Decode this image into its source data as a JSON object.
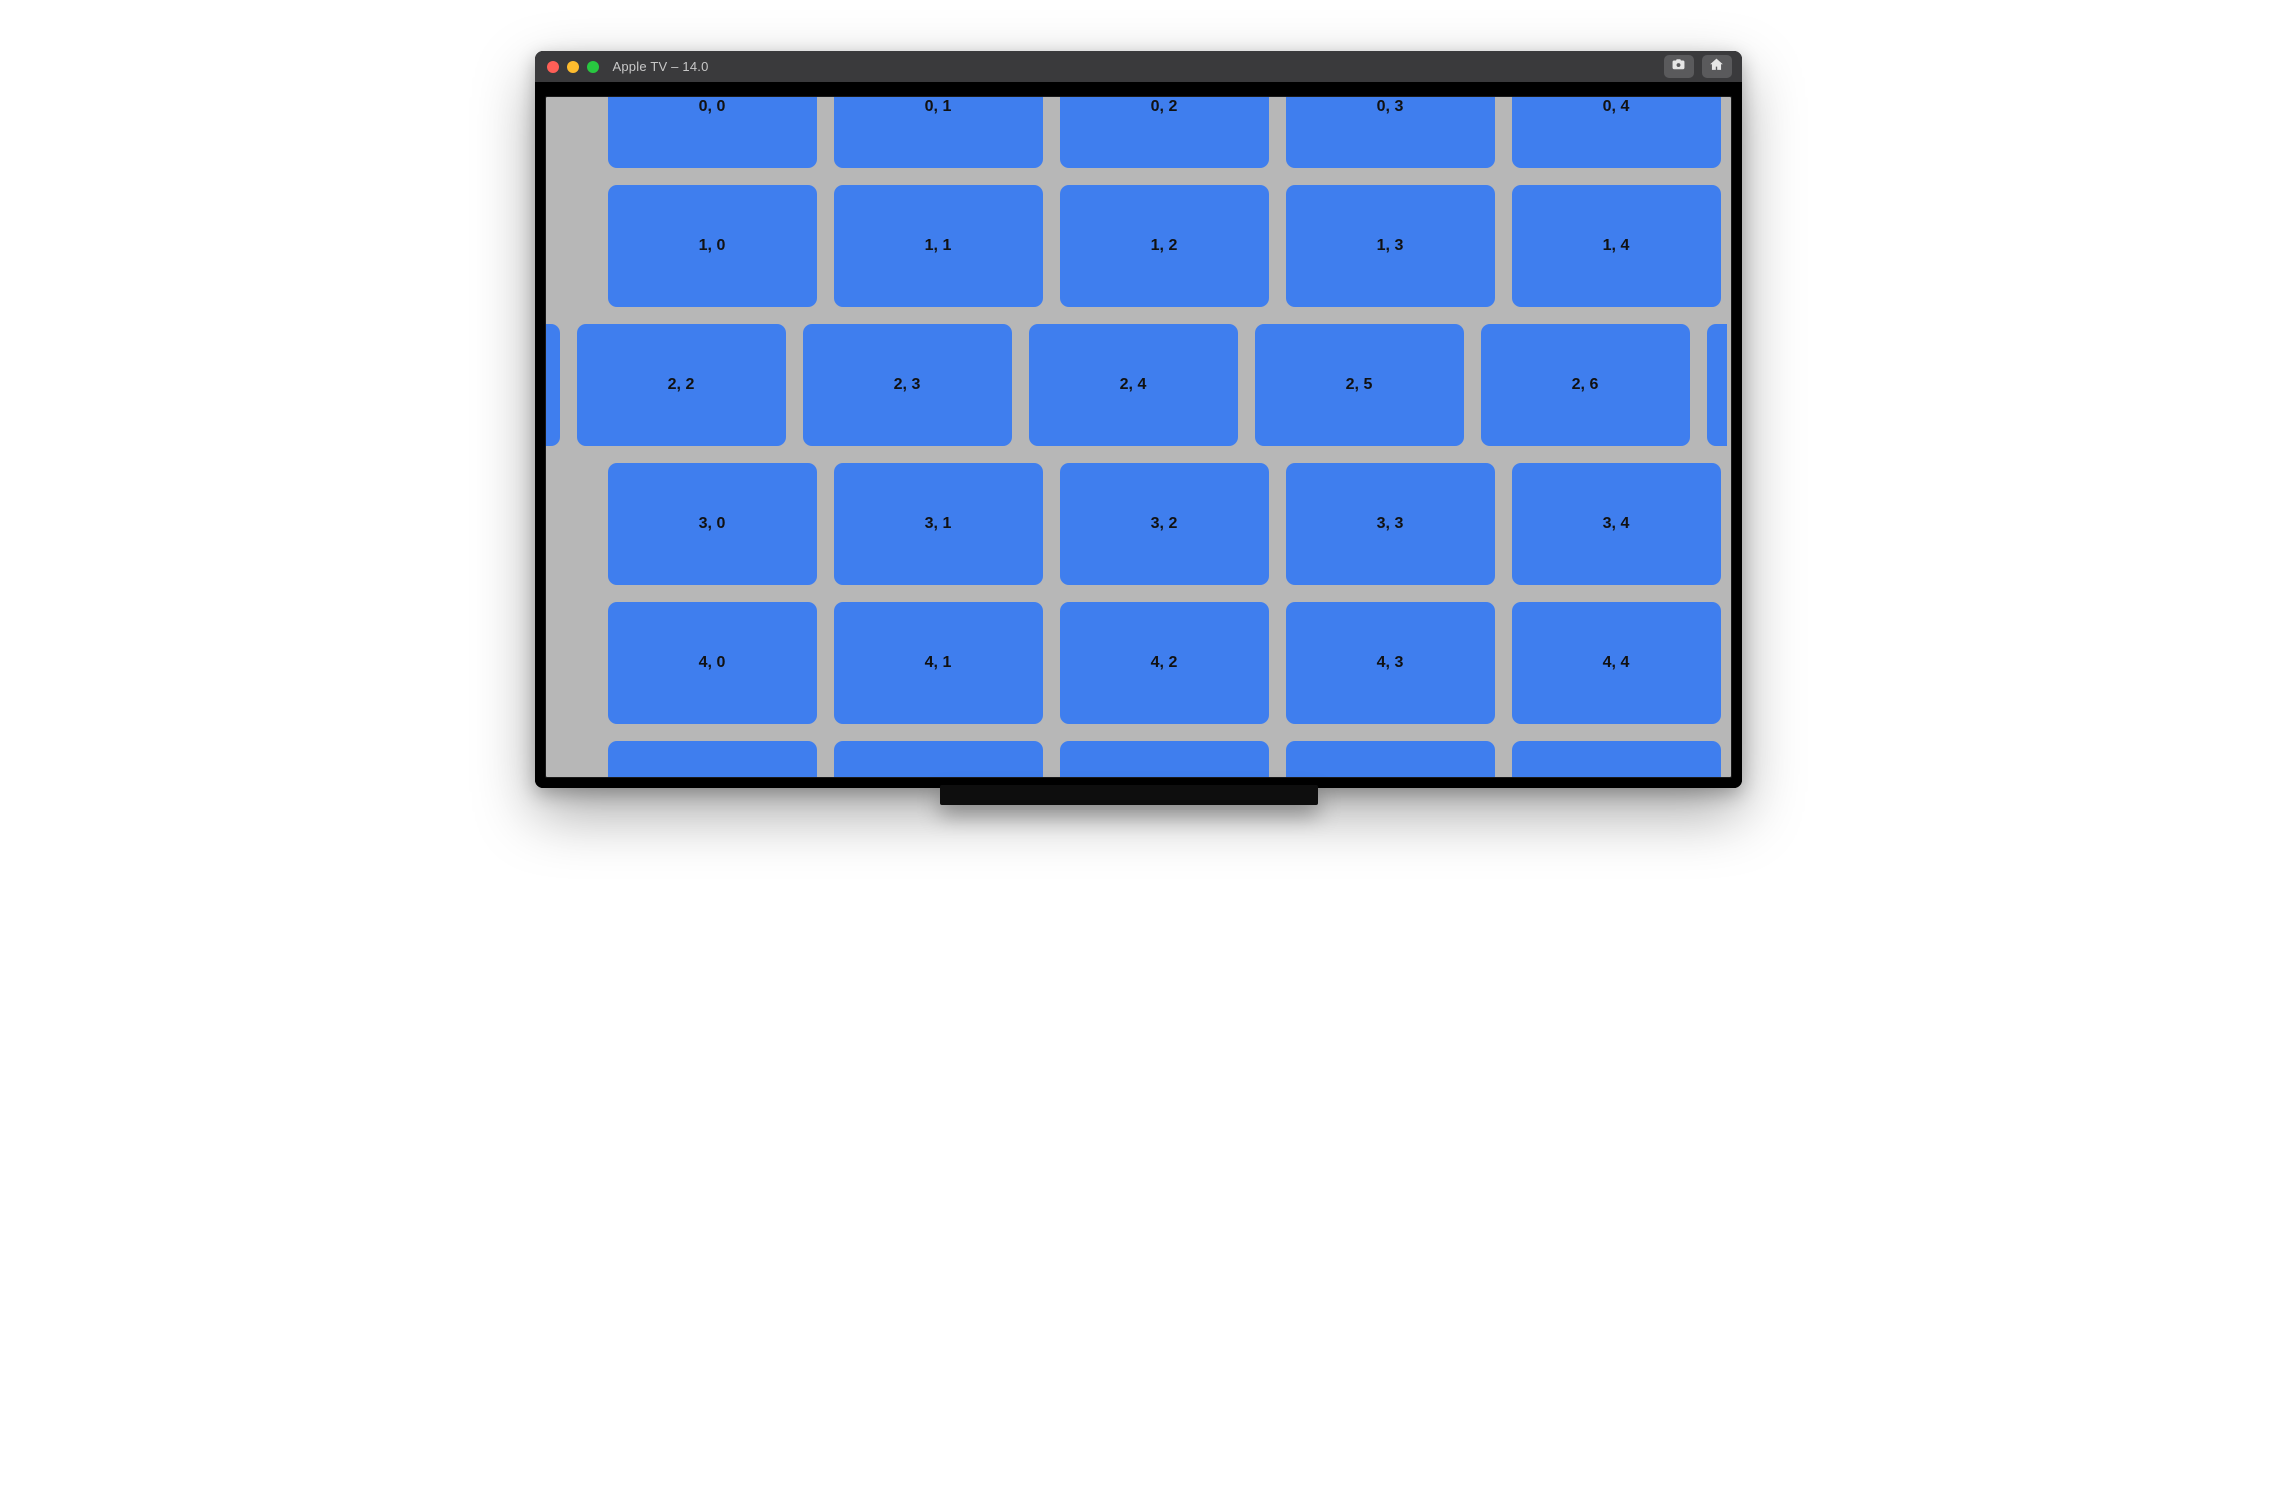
{
  "titlebar": {
    "title": "Apple TV – 14.0"
  },
  "colors": {
    "tile": "#3f7eee",
    "screen_bg": "#b7b7b7",
    "titlebar_bg": "#3a3a3c"
  },
  "grid": {
    "rows": [
      {
        "prefix_sliver": false,
        "left_edge_first": false,
        "left_pad": 45,
        "tiles": [
          "0, 0",
          "0, 1",
          "0, 2",
          "0, 3",
          "0, 4"
        ],
        "suffix_sliver": true
      },
      {
        "prefix_sliver": false,
        "left_edge_first": false,
        "left_pad": 45,
        "tiles": [
          "1, 0",
          "1, 1",
          "1, 2",
          "1, 3",
          "1, 4"
        ],
        "suffix_sliver": true
      },
      {
        "prefix_sliver": true,
        "left_edge_first": false,
        "left_pad": 0,
        "tiles": [
          "2, 2",
          "2, 3",
          "2, 4",
          "2, 5",
          "2, 6"
        ],
        "suffix_sliver": true
      },
      {
        "prefix_sliver": false,
        "left_edge_first": false,
        "left_pad": 45,
        "tiles": [
          "3, 0",
          "3, 1",
          "3, 2",
          "3, 3",
          "3, 4"
        ],
        "suffix_sliver": true
      },
      {
        "prefix_sliver": false,
        "left_edge_first": false,
        "left_pad": 45,
        "tiles": [
          "4, 0",
          "4, 1",
          "4, 2",
          "4, 3",
          "4, 4"
        ],
        "suffix_sliver": true
      },
      {
        "prefix_sliver": false,
        "left_edge_first": false,
        "left_pad": 45,
        "tiles": [
          "",
          "",
          "",
          "",
          ""
        ],
        "suffix_sliver": true
      }
    ]
  }
}
